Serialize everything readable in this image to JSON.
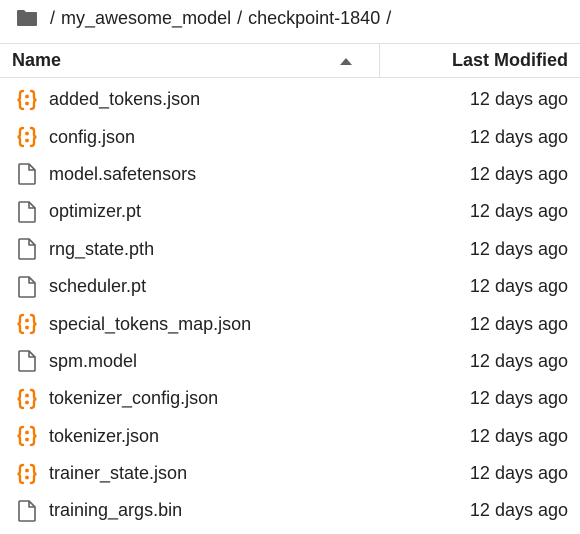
{
  "breadcrumb": {
    "separator": "/",
    "parts": [
      "my_awesome_model",
      "checkpoint-1840"
    ]
  },
  "header": {
    "name_label": "Name",
    "modified_label": "Last Modified",
    "sort": "name-ascending"
  },
  "colors": {
    "json_icon": "#f57c00",
    "file_icon": "#616161",
    "folder_icon": "#616161"
  },
  "files": [
    {
      "name": "added_tokens.json",
      "modified": "12 days ago",
      "icon": "json-icon"
    },
    {
      "name": "config.json",
      "modified": "12 days ago",
      "icon": "json-icon"
    },
    {
      "name": "model.safetensors",
      "modified": "12 days ago",
      "icon": "file-icon"
    },
    {
      "name": "optimizer.pt",
      "modified": "12 days ago",
      "icon": "file-icon"
    },
    {
      "name": "rng_state.pth",
      "modified": "12 days ago",
      "icon": "file-icon"
    },
    {
      "name": "scheduler.pt",
      "modified": "12 days ago",
      "icon": "file-icon"
    },
    {
      "name": "special_tokens_map.json",
      "modified": "12 days ago",
      "icon": "json-icon"
    },
    {
      "name": "spm.model",
      "modified": "12 days ago",
      "icon": "file-icon"
    },
    {
      "name": "tokenizer_config.json",
      "modified": "12 days ago",
      "icon": "json-icon"
    },
    {
      "name": "tokenizer.json",
      "modified": "12 days ago",
      "icon": "json-icon"
    },
    {
      "name": "trainer_state.json",
      "modified": "12 days ago",
      "icon": "json-icon"
    },
    {
      "name": "training_args.bin",
      "modified": "12 days ago",
      "icon": "file-icon"
    }
  ]
}
